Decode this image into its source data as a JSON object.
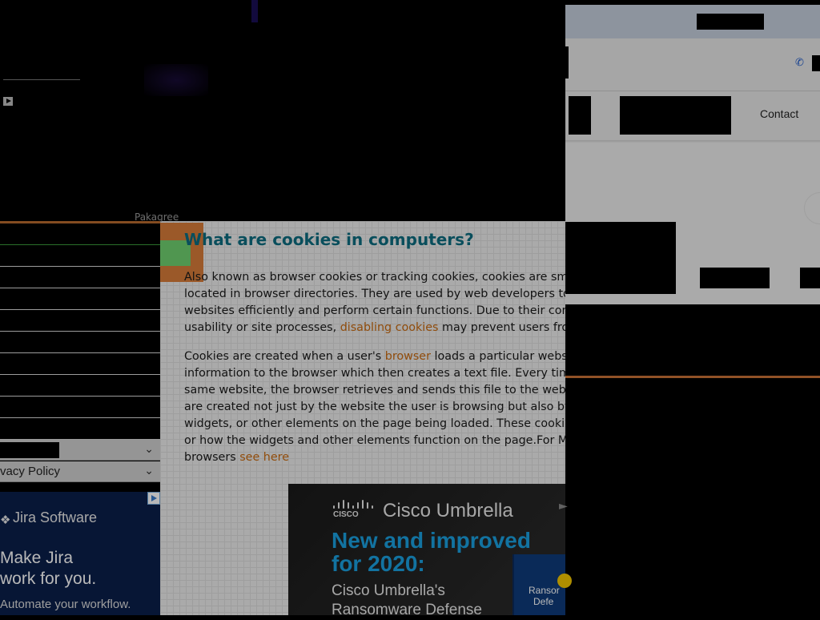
{
  "video": {
    "play_icon": "play-icon"
  },
  "header": {
    "phone_icon": "phone-icon",
    "nav": {
      "contact_label": "Contact"
    }
  },
  "sidebar": {
    "partial_label": "Pakagree",
    "row_count": 10,
    "expanders": [
      {
        "label": "",
        "icon": "chevron-down-icon"
      },
      {
        "label": "vacy Policy",
        "icon": "chevron-down-icon"
      }
    ]
  },
  "article": {
    "title": "What are cookies in computers?",
    "para1": {
      "text_before": "Also known as browser cookies or tracking cookies, cookies are smal",
      "line2": "located in browser directories. They are used by web developers to h",
      "line3": "websites efficiently and perform certain functions. Due to their core r",
      "line4_before": "usability or site processes, ",
      "link": "disabling cookies",
      "line4_after": " may prevent users from"
    },
    "para2": {
      "line1_before": "Cookies are created when a user's ",
      "link1": "browser",
      "line1_after": " loads a particular website",
      "line2": "information to the browser which then creates a text file. Every time t",
      "line3": "same website, the browser retrieves and sends this file to the website",
      "line4": "are created not just by the website the user is browsing but also by o",
      "line5": "widgets, or other elements on the page being loaded. These cookies r",
      "line6": "or how the widgets and other elements function on the page.For Ma",
      "line7_before": "browsers ",
      "link2": "see here"
    }
  },
  "ads": {
    "cisco": {
      "brand": "Cisco Umbrella",
      "headline_line1": "New and improved",
      "headline_line2": "for 2020:",
      "sub_line1": "Cisco Umbrella's",
      "sub_line2": "Ransomware Defense",
      "book_line1": "Ransor",
      "book_line2": "Defe"
    },
    "jira": {
      "brand": "Jira Software",
      "headline_line1": "Make Jira",
      "headline_line2": "work for you.",
      "sub": "Automate your workflow."
    }
  },
  "colors": {
    "link": "#c86a10",
    "title": "#0d6d80",
    "accent_orange": "#c97236",
    "cisco_blue": "#1aa0e0",
    "jira_bg": "#0a1f4a"
  }
}
